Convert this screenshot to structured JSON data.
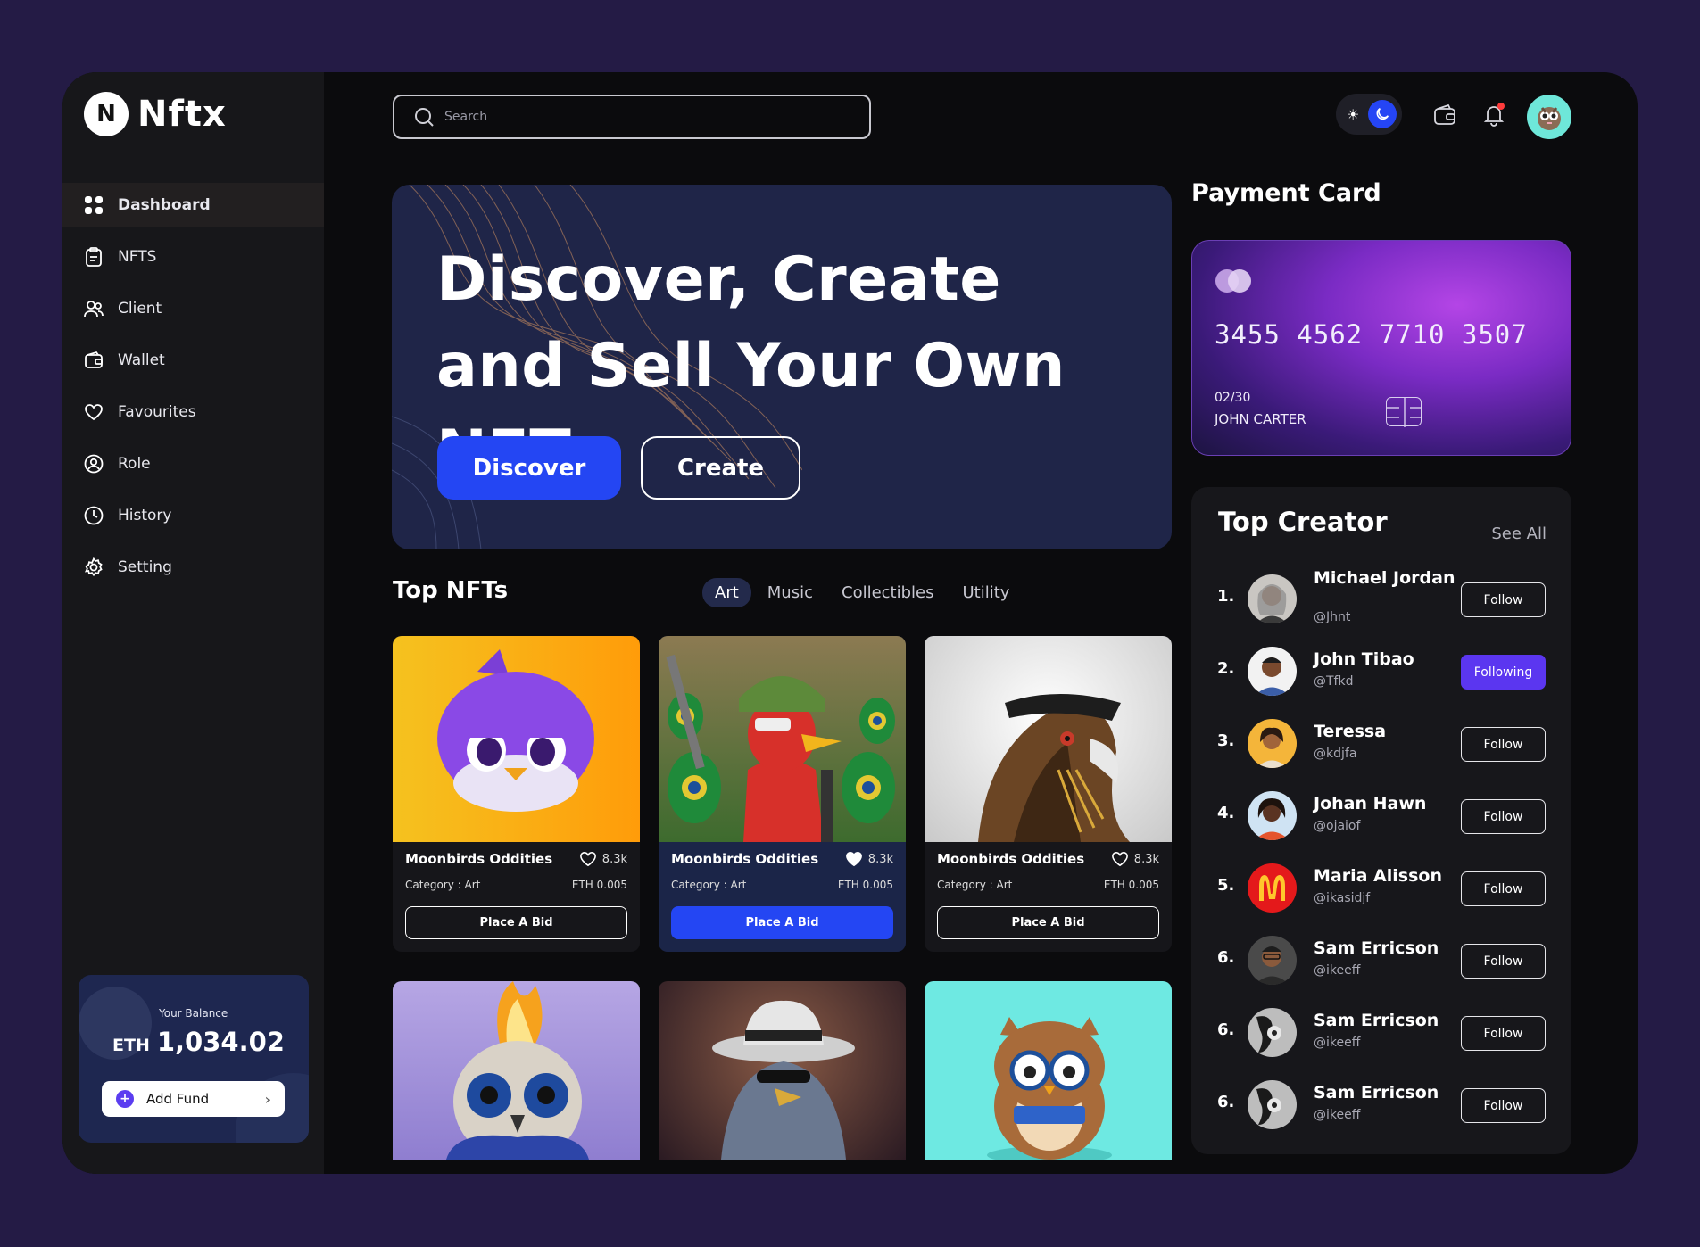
{
  "app": {
    "logo_letter": "N",
    "logo_text": "Nftx"
  },
  "sidebar": {
    "items": [
      {
        "label": "Dashboard",
        "icon": "grid-icon",
        "active": true
      },
      {
        "label": "NFTS",
        "icon": "clipboard-icon"
      },
      {
        "label": "Client",
        "icon": "users-icon"
      },
      {
        "label": "Wallet",
        "icon": "wallet-icon"
      },
      {
        "label": "Favourites",
        "icon": "heart-icon"
      },
      {
        "label": "Role",
        "icon": "user-shield-icon"
      },
      {
        "label": "History",
        "icon": "clock-icon"
      },
      {
        "label": "Setting",
        "icon": "gear-icon"
      }
    ],
    "balance": {
      "label": "Your Balance",
      "currency": "ETH",
      "value": "1,034.02",
      "add_fund": "Add Fund"
    }
  },
  "header": {
    "search_placeholder": "Search",
    "theme": "dark",
    "icons": [
      "sun-icon",
      "moon-icon",
      "wallet-icon",
      "bell-icon",
      "avatar"
    ]
  },
  "hero": {
    "title": "Discover, Create and Sell Your Own NFT.",
    "discover_label": "Discover",
    "create_label": "Create"
  },
  "top_nfts": {
    "title": "Top NFTs",
    "tabs": [
      "Art",
      "Music",
      "Collectibles",
      "Utility"
    ],
    "active_tab": "Art",
    "cards": [
      {
        "name": "Moonbirds Oddities",
        "likes": "8.3k",
        "category": "Category : Art",
        "price": "ETH 0.005",
        "bid_label": "Place A Bid",
        "liked": false
      },
      {
        "name": "Moonbirds Oddities",
        "likes": "8.3k",
        "category": "Category : Art",
        "price": "ETH 0.005",
        "bid_label": "Place A Bid",
        "liked": true
      },
      {
        "name": "Moonbirds Oddities",
        "likes": "8.3k",
        "category": "Category : Art",
        "price": "ETH 0.005",
        "bid_label": "Place A Bid",
        "liked": false
      }
    ]
  },
  "payment": {
    "title": "Payment Card",
    "card_number": "3455 4562 7710 3507",
    "expiry": "02/30",
    "holder": "JOHN CARTER"
  },
  "creators": {
    "title": "Top Creator",
    "see_all": "See All",
    "list": [
      {
        "rank": "1.",
        "name": "Michael Jordan",
        "handle": "@Jhnt",
        "action": "Follow"
      },
      {
        "rank": "2.",
        "name": "John Tibao",
        "handle": "@Tfkd",
        "action": "Following"
      },
      {
        "rank": "3.",
        "name": "Teressa",
        "handle": "@kdjfa",
        "action": "Follow"
      },
      {
        "rank": "4.",
        "name": "Johan Hawn",
        "handle": "@ojaiof",
        "action": "Follow"
      },
      {
        "rank": "5.",
        "name": "Maria Alisson",
        "handle": "@ikasidjf",
        "action": "Follow"
      },
      {
        "rank": "6.",
        "name": "Sam Erricson",
        "handle": "@ikeeff",
        "action": "Follow"
      },
      {
        "rank": "6.",
        "name": "Sam Erricson",
        "handle": "@ikeeff",
        "action": "Follow"
      },
      {
        "rank": "6.",
        "name": "Sam Erricson",
        "handle": "@ikeeff",
        "action": "Follow"
      }
    ]
  },
  "colors": {
    "accent_blue": "#2446f3",
    "accent_purple": "#5b36f0",
    "frame_bg": "#0b0b0d",
    "hero_bg": "#1f2548",
    "page_bg": "#241b45"
  }
}
